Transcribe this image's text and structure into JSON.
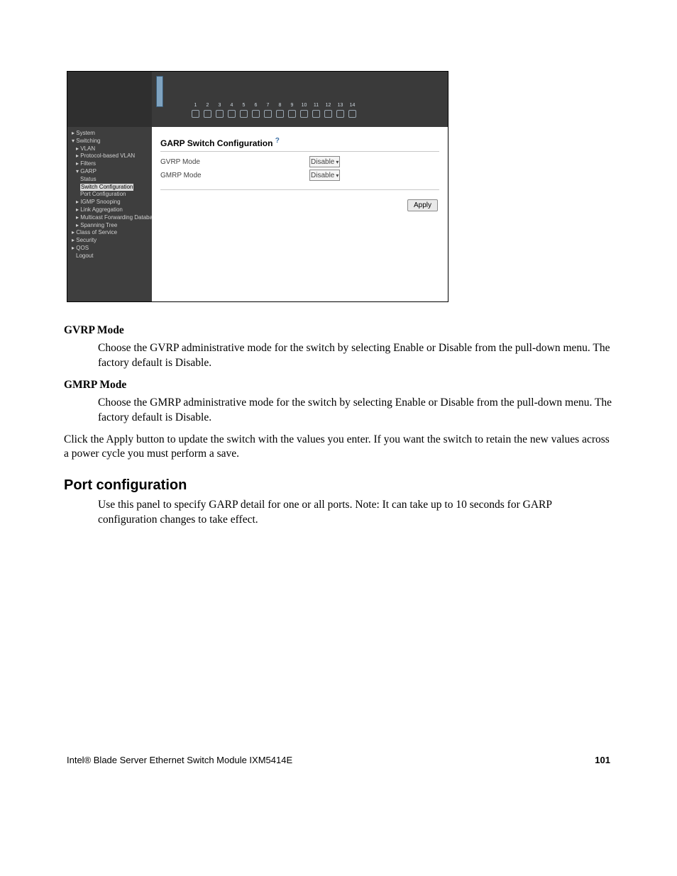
{
  "screenshot": {
    "port_numbers": [
      "1",
      "2",
      "3",
      "4",
      "5",
      "6",
      "7",
      "8",
      "9",
      "10",
      "11",
      "12",
      "13",
      "14"
    ],
    "nav": {
      "system": "System",
      "switching": "Switching",
      "vlan": "VLAN",
      "protocol_vlan": "Protocol-based VLAN",
      "filters": "Filters",
      "garp": "GARP",
      "status": "Status",
      "switch_config": "Switch Configuration",
      "port_config": "Port Configuration",
      "igmp": "IGMP Snooping",
      "link_agg": "Link Aggregation",
      "mfd": "Multicast Forwarding Database",
      "spanning": "Spanning Tree",
      "cos": "Class of Service",
      "security": "Security",
      "qos": "QOS",
      "logout": "Logout"
    },
    "panel": {
      "title": "GARP Switch Configuration",
      "help_glyph": "?",
      "rows": {
        "gvrp_label": "GVRP Mode",
        "gmrp_label": "GMRP Mode"
      },
      "gvrp_value": "Disable",
      "gmrp_value": "Disable",
      "apply": "Apply"
    }
  },
  "doc": {
    "dl": {
      "term1": "GVRP Mode",
      "def1": "Choose the GVRP administrative mode for the switch by selecting Enable or Disable from the pull-down menu. The factory default is Disable.",
      "term2": "GMRP Mode",
      "def2": "Choose the GMRP administrative mode for the switch by selecting Enable or Disable from the pull-down menu. The factory default is Disable."
    },
    "apply_para": "Click the Apply button to update the switch with the values you enter. If you want the switch to retain the new values across a power cycle you must perform a save.",
    "section_heading": "Port configuration",
    "section_body": "Use this panel to specify GARP detail for one or all ports. Note: It can take up to 10 seconds for GARP configuration changes to take effect."
  },
  "footer": {
    "product": "Intel® Blade Server Ethernet Switch Module IXM5414E",
    "page": "101"
  }
}
